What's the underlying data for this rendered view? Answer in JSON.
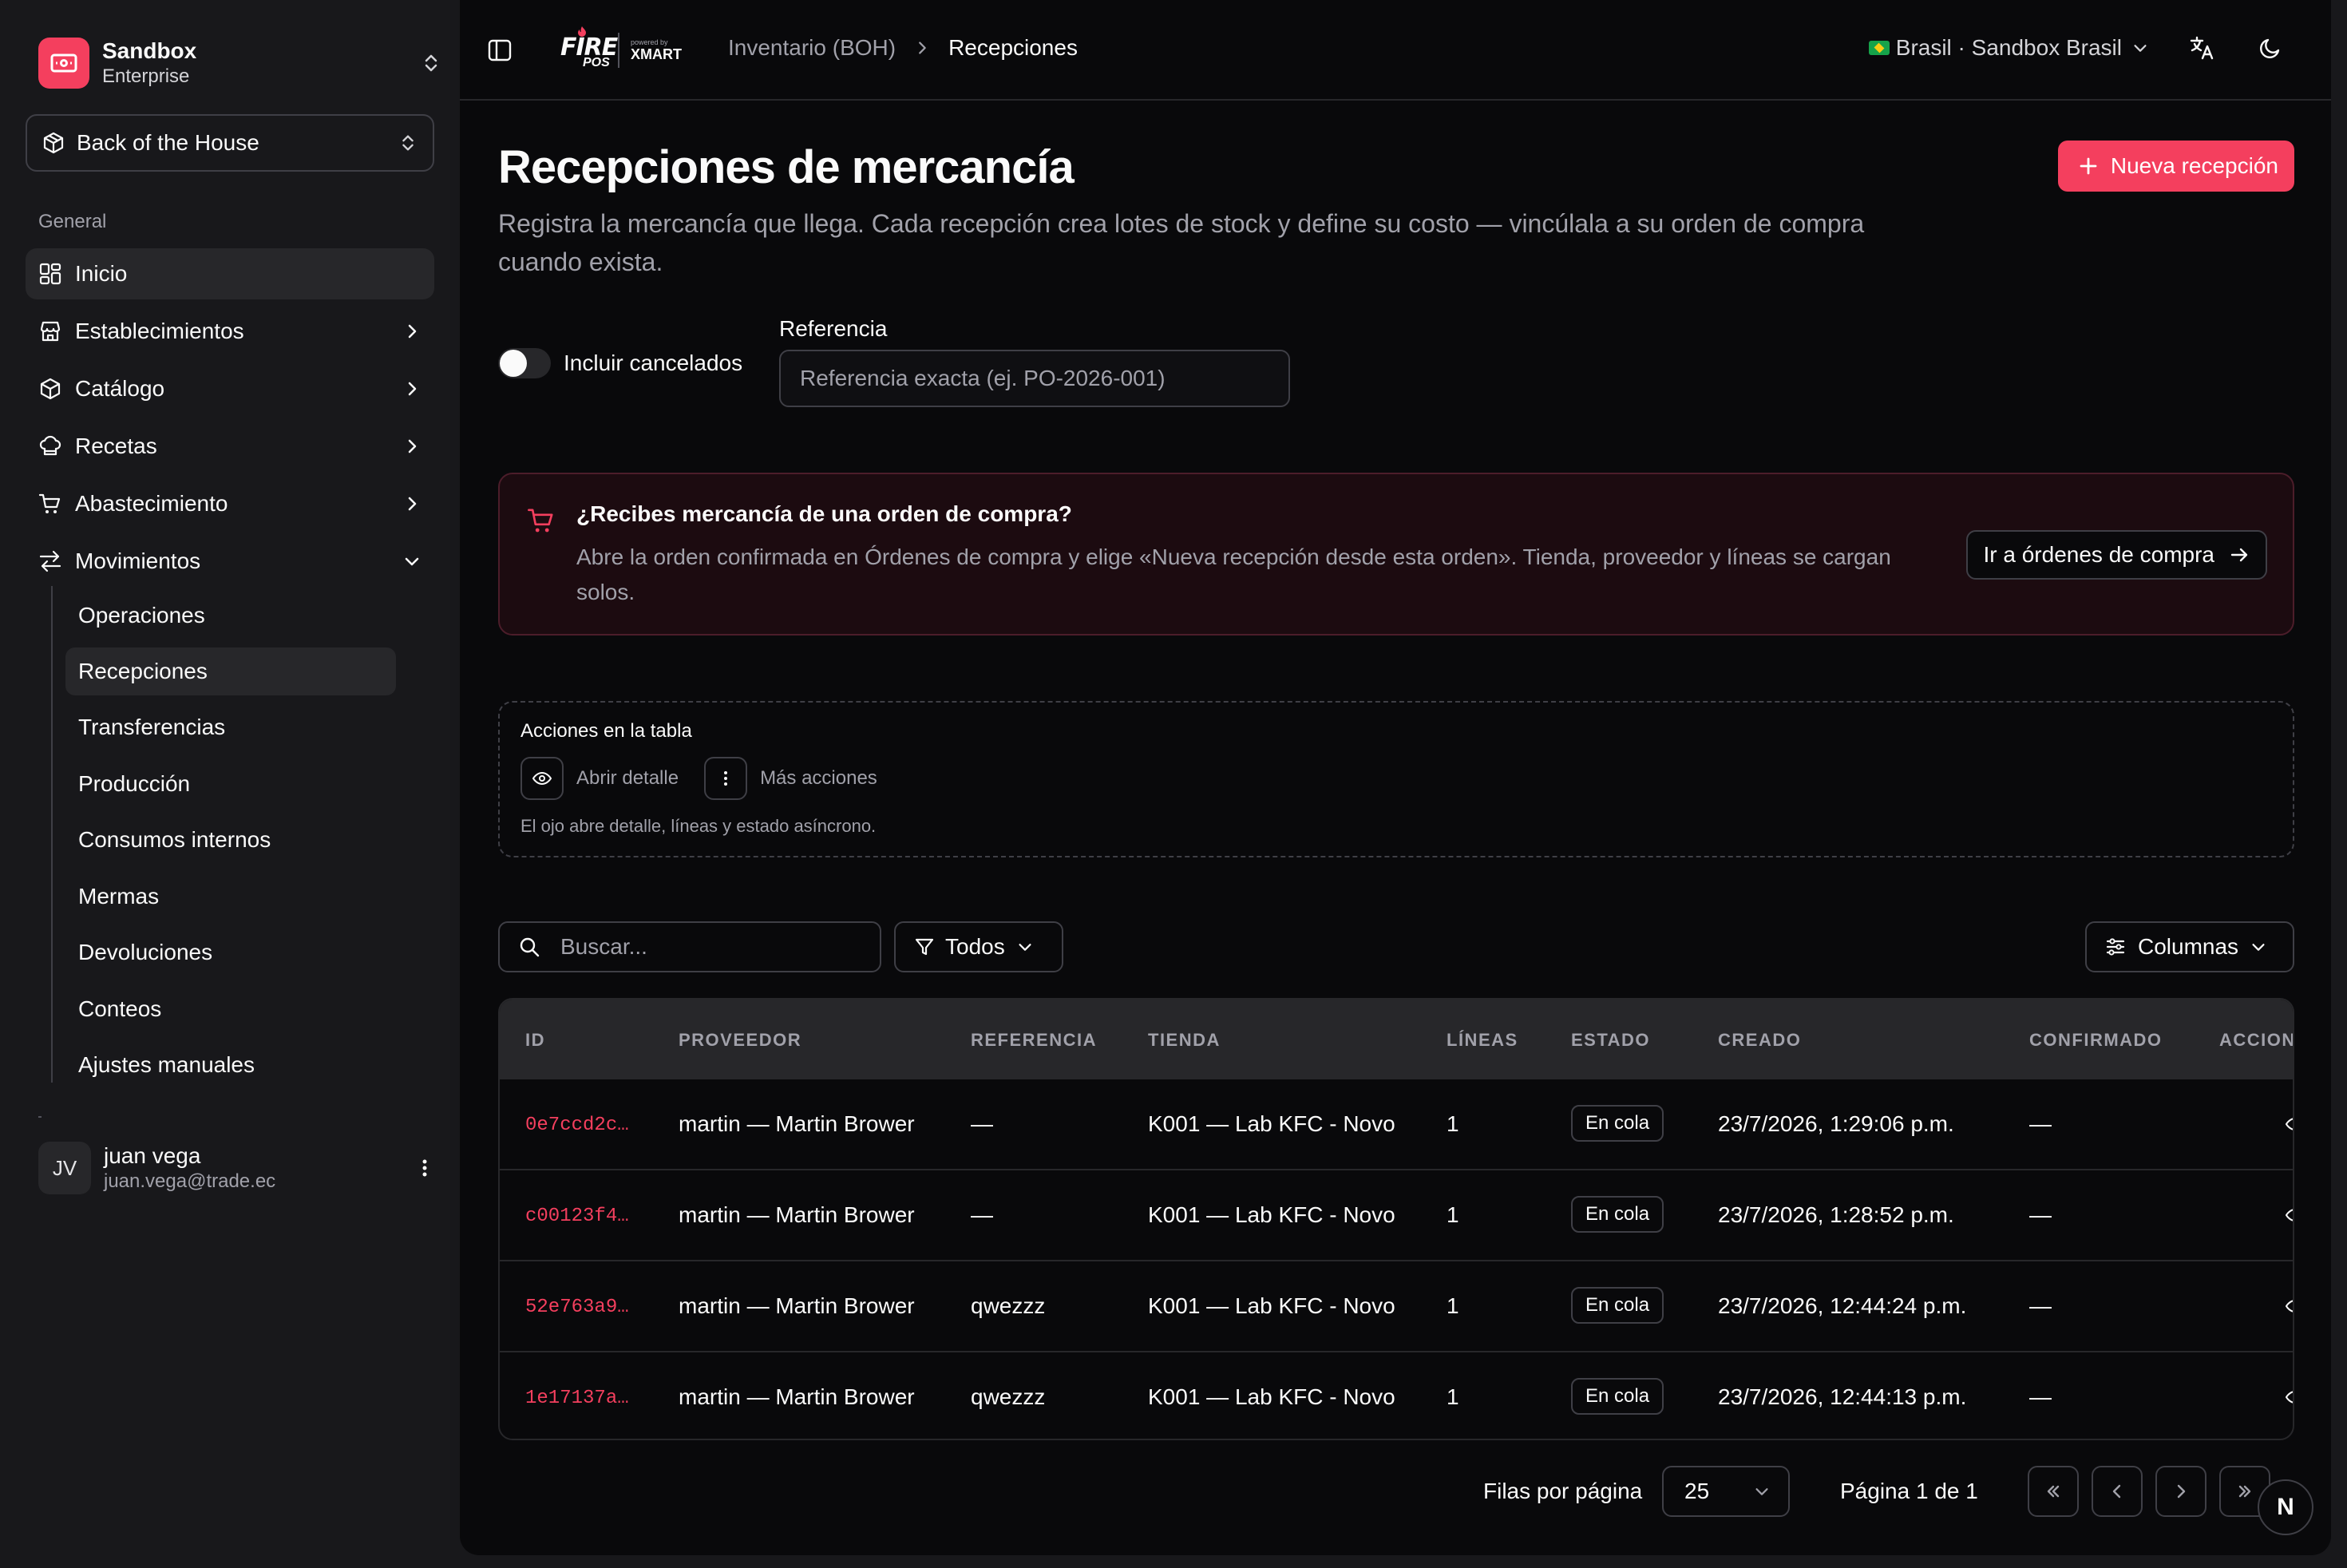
{
  "org": {
    "name": "Sandbox",
    "plan": "Enterprise"
  },
  "area": {
    "label": "Back of the House"
  },
  "nav": {
    "section": "General",
    "items": [
      {
        "label": "Inicio",
        "icon": "dashboard-icon"
      },
      {
        "label": "Establecimientos",
        "icon": "store-icon"
      },
      {
        "label": "Catálogo",
        "icon": "box-icon"
      },
      {
        "label": "Recetas",
        "icon": "chef-hat-icon"
      },
      {
        "label": "Abastecimiento",
        "icon": "cart-icon"
      },
      {
        "label": "Movimientos",
        "icon": "arrows-icon"
      }
    ],
    "movimientos_sub": [
      "Operaciones",
      "Recepciones",
      "Transferencias",
      "Producción",
      "Consumos internos",
      "Mermas",
      "Devoluciones",
      "Conteos",
      "Ajustes manuales"
    ]
  },
  "user": {
    "initials": "JV",
    "name": "juan vega",
    "email": "juan.vega@trade.ec"
  },
  "brand": {
    "fire": "FIRE",
    "pos": "POS",
    "powered": "powered by",
    "xmart": "XMART"
  },
  "breadcrumb": {
    "parent": "Inventario (BOH)",
    "current": "Recepciones"
  },
  "tenant": {
    "label": "Brasil · Sandbox Brasil"
  },
  "page": {
    "title": "Recepciones de mercancía",
    "subtitle": "Registra la mercancía que llega. Cada recepción crea lotes de stock y define su costo — vincúlala a su orden de compra cuando exista.",
    "new_button": "Nueva recepción"
  },
  "filters": {
    "include_cancelled_label": "Incluir cancelados",
    "include_cancelled": false,
    "reference_label": "Referencia",
    "reference_placeholder": "Referencia exacta (ej. PO-2026-001)"
  },
  "callout": {
    "title": "¿Recibes mercancía de una orden de compra?",
    "text": "Abre la orden confirmada en Órdenes de compra y elige «Nueva recepción desde esta orden». Tienda, proveedor y líneas se cargan solos.",
    "button": "Ir a órdenes de compra"
  },
  "legend": {
    "title": "Acciones en la tabla",
    "open_detail": "Abrir detalle",
    "more_actions": "Más acciones",
    "note": "El ojo abre detalle, líneas y estado asíncrono."
  },
  "toolbar": {
    "search_placeholder": "Buscar...",
    "filter_label": "Todos",
    "columns_label": "Columnas"
  },
  "table": {
    "headers": {
      "id": "ID",
      "supplier": "PROVEEDOR",
      "reference": "REFERENCIA",
      "store": "TIENDA",
      "lines": "LÍNEAS",
      "status": "ESTADO",
      "created": "CREADO",
      "confirmed": "CONFIRMADO",
      "actions": "ACCION"
    },
    "rows": [
      {
        "id": "0e7ccd2c…",
        "supplier": "martin — Martin Brower",
        "reference": "—",
        "store": "K001 — Lab KFC - Novo",
        "lines": "1",
        "status": "En cola",
        "created": "23/7/2026, 1:29:06 p.m.",
        "confirmed": "—"
      },
      {
        "id": "c00123f4…",
        "supplier": "martin — Martin Brower",
        "reference": "—",
        "store": "K001 — Lab KFC - Novo",
        "lines": "1",
        "status": "En cola",
        "created": "23/7/2026, 1:28:52 p.m.",
        "confirmed": "—"
      },
      {
        "id": "52e763a9…",
        "supplier": "martin — Martin Brower",
        "reference": "qwezzz",
        "store": "K001 — Lab KFC - Novo",
        "lines": "1",
        "status": "En cola",
        "created": "23/7/2026, 12:44:24 p.m.",
        "confirmed": "—"
      },
      {
        "id": "1e17137a…",
        "supplier": "martin — Martin Brower",
        "reference": "qwezzz",
        "store": "K001 — Lab KFC - Novo",
        "lines": "1",
        "status": "En cola",
        "created": "23/7/2026, 12:44:13 p.m.",
        "confirmed": "—"
      }
    ]
  },
  "pagination": {
    "rows_per_page_label": "Filas por página",
    "rows_per_page": "25",
    "page_label": "Página 1 de 1"
  },
  "fab_label": "N",
  "colors": {
    "accent": "#f43f5e",
    "background": "#09090b",
    "sidebar": "#18181b",
    "border": "#3f3f46"
  }
}
